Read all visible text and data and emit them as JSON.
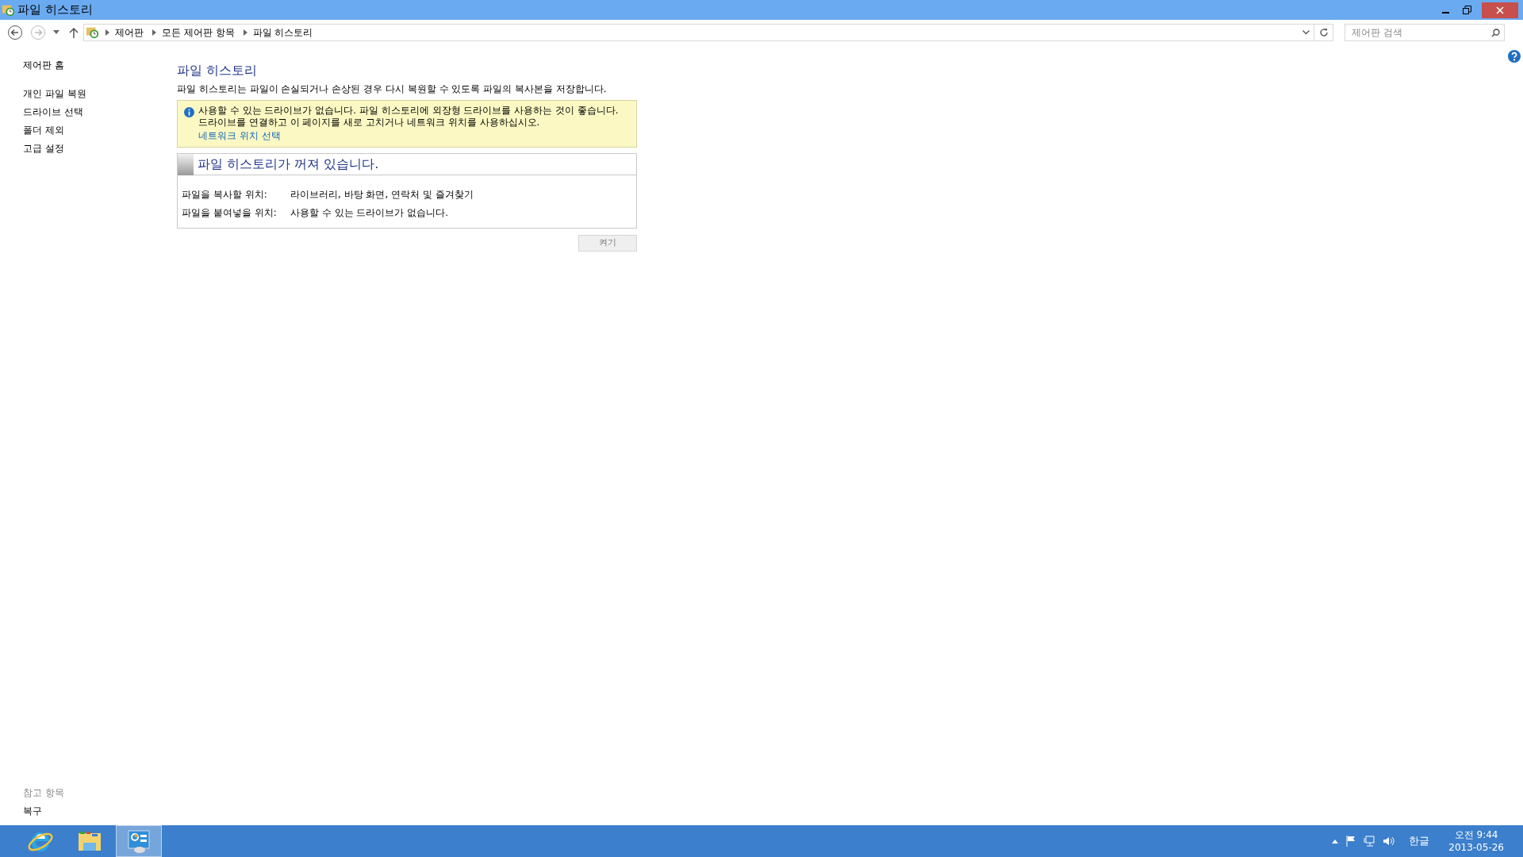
{
  "window": {
    "title": "파일 히스토리"
  },
  "address_bar": {
    "crumbs": [
      "제어판",
      "모든 제어판 항목",
      "파일 히스토리"
    ]
  },
  "search": {
    "placeholder": "제어판 검색"
  },
  "sidebar": {
    "items": [
      "제어판 홈",
      "개인 파일 복원",
      "드라이브 선택",
      "폴더 제외",
      "고급 설정"
    ],
    "see_also": {
      "heading": "참고 항목",
      "items": [
        "복구"
      ]
    }
  },
  "main": {
    "title": "파일 히스토리",
    "description": "파일 히스토리는 파일이 손실되거나 손상된 경우 다시 복원할 수 있도록 파일의 복사본을 저장합니다.",
    "notice": {
      "lines": [
        "사용할 수 있는 드라이브가 없습니다. 파일 히스토리에 외장형 드라이브를 사용하는 것이 좋습니다.",
        "드라이브를 연결하고 이 페이지를 새로 고치거나 네트워크 위치를 사용하십시오."
      ],
      "link": "네트워크 위치 선택"
    },
    "status": {
      "title": "파일 히스토리가 꺼져 있습니다.",
      "on": false,
      "rows": [
        {
          "label": "파일을 복사할 위치:",
          "value": "라이브러리, 바탕 화면, 연락처 및 즐겨찾기"
        },
        {
          "label": "파일을 붙여넣을 위치:",
          "value": "사용할 수 있는 드라이브가 없습니다."
        }
      ]
    },
    "button": {
      "label": "켜기",
      "disabled": true
    }
  },
  "taskbar": {
    "apps": [
      {
        "kind": "browser",
        "selected": false
      },
      {
        "kind": "folder",
        "selected": false
      },
      {
        "kind": "control-panel",
        "selected": true
      }
    ],
    "ime": "한글",
    "time": "오전 9:44",
    "date": "2013-05-26"
  }
}
